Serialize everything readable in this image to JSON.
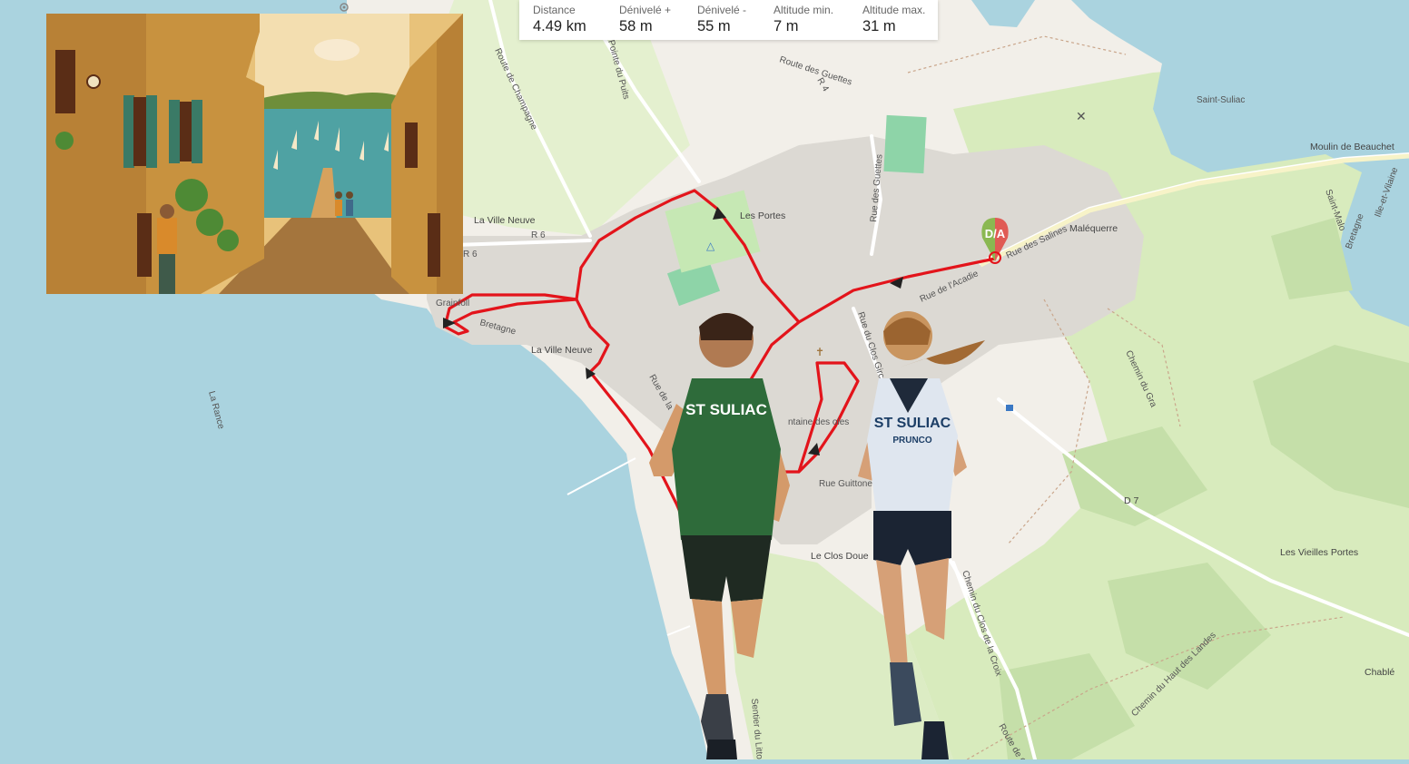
{
  "stats": {
    "distance": {
      "label": "Distance",
      "value": "4.49 km"
    },
    "elevation_gain": {
      "label": "Dénivelé +",
      "value": "58 m"
    },
    "elevation_loss": {
      "label": "Dénivelé -",
      "value": "55 m"
    },
    "altitude_min": {
      "label": "Altitude min.",
      "value": "7 m"
    },
    "altitude_max": {
      "label": "Altitude max.",
      "value": "31 m"
    }
  },
  "map": {
    "start_marker": "D/A",
    "colors": {
      "route": "#e3141b",
      "water": "#aad3df",
      "land": "#f2efe9",
      "fields": "#d6ebb9",
      "built": "#d9d6d0",
      "start_marker_left": "#8ab851",
      "start_marker_right": "#e05b55"
    },
    "labels": {
      "la_ville_neuve_top": "La Ville Neuve",
      "la_ville_neuve_mid": "La Ville Neuve",
      "grainfoll": "Grainfoll",
      "bretagne": "Bretagne",
      "la_rance": "La Rance",
      "route_de_champagne": "Route de Champagne",
      "pointe_du_puits": "Pointe du Puits",
      "les_portes": "Les Portes",
      "route_des_guettes": "Route des Guettes",
      "rue_des_guettes": "Rue des Guettes",
      "rue_des_salines": "Rue des Salines",
      "malequerre": "Maléquerre",
      "moulin_de_beauchet": "Moulin de Beauchet",
      "saint_suliac": "Saint-Suliac",
      "rue_du_clos_gircourt": "Rue du Clos Gircourt",
      "rue_de_lacadie": "Rue de l'Acadie",
      "fontaine_des_ecoles": "ntaine des oles",
      "rue_guittone": "Rue Guittone",
      "le_clos_doue": "Le Clos Doue",
      "chemin_du_clos_de_la_croix": "Chemin du Clos de la Croix",
      "d7": "D 7",
      "les_vieilles_portes": "Les Vieilles Portes",
      "chable": "Chablé",
      "chemin_du_haut_des_landes": "Chemin du Haut des Landes",
      "sentier_du_littoral": "Sentier du Littoral",
      "route_de_ch": "Route de Ch",
      "r6": "R 6",
      "r4": "R 4",
      "bretagne_right": "Bretagne",
      "ille_et_vilaine": "Ille-et-Vilaine",
      "saint_malo": "Saint-Malo",
      "chemin_du_grand": "Chemin du Gra",
      "rue_de_rance": "Rue de la"
    }
  },
  "runners": {
    "man_shirt": "ST SULIAC",
    "woman_shirt": "ST SULIAC",
    "woman_subtext": "PRUNCO"
  },
  "illustration": {
    "subject": "village-street-harbor-illustration"
  }
}
